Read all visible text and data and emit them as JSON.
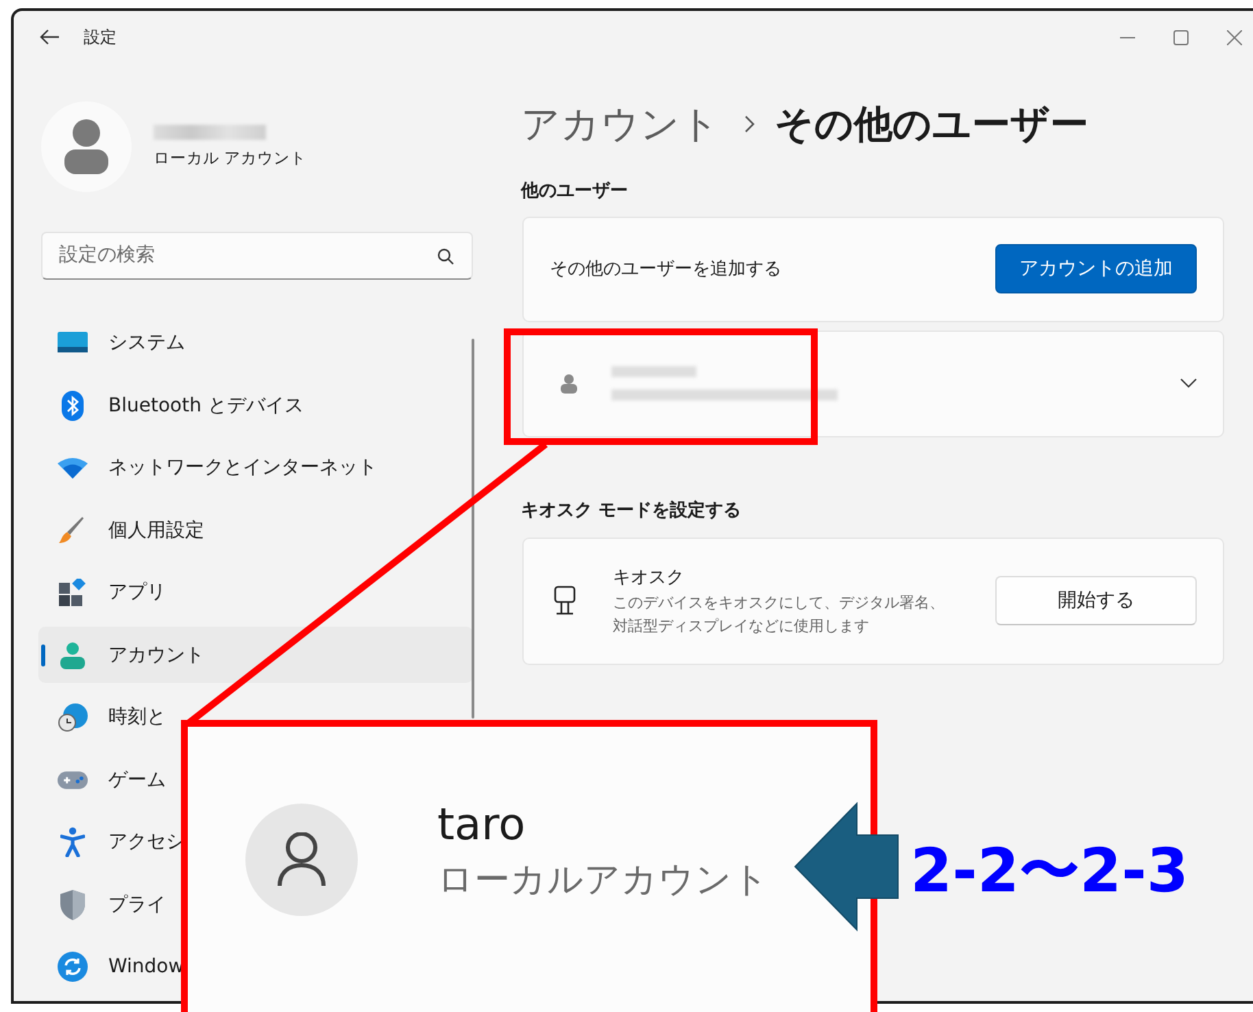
{
  "window": {
    "title": "設定"
  },
  "profile": {
    "account_type": "ローカル アカウント"
  },
  "search": {
    "placeholder": "設定の検索"
  },
  "nav": [
    {
      "label": "システム",
      "kind": "system",
      "selected": false
    },
    {
      "label": "Bluetooth とデバイス",
      "kind": "bluetooth",
      "selected": false
    },
    {
      "label": "ネットワークとインターネット",
      "kind": "network",
      "selected": false
    },
    {
      "label": "個人用設定",
      "kind": "brush",
      "selected": false
    },
    {
      "label": "アプリ",
      "kind": "apps",
      "selected": false
    },
    {
      "label": "アカウント",
      "kind": "account",
      "selected": true
    },
    {
      "label": "時刻と",
      "kind": "time",
      "selected": false
    },
    {
      "label": "ゲーム",
      "kind": "game",
      "selected": false
    },
    {
      "label": "アクセシ",
      "kind": "accessibility",
      "selected": false
    },
    {
      "label": "プライ",
      "kind": "privacy",
      "selected": false
    },
    {
      "label": "Window",
      "kind": "update",
      "selected": false
    }
  ],
  "breadcrumb": {
    "parent": "アカウント",
    "current": "その他のユーザー"
  },
  "other_users": {
    "heading": "他のユーザー",
    "add_label": "その他のユーザーを追加する",
    "add_button": "アカウントの追加",
    "user_row": {
      "expanded": false
    }
  },
  "kiosk": {
    "heading": "キオスク モードを設定する",
    "title": "キオスク",
    "description": "このデバイスをキオスクにして、デジタル署名、対話型ディスプレイなどに使用します",
    "button": "開始する"
  },
  "callout": {
    "name": "taro",
    "account_type": "ローカルアカウント",
    "label": "2-2〜2-3"
  }
}
